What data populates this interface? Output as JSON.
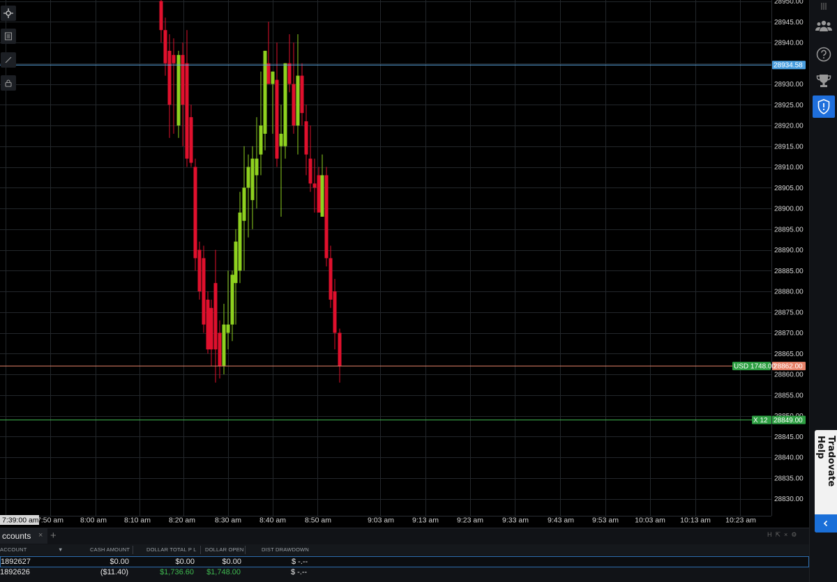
{
  "chart": {
    "price_labels": [
      "28950.00",
      "28945.00",
      "28940.00",
      "28930.00",
      "28925.00",
      "28920.00",
      "28915.00",
      "28910.00",
      "28905.00",
      "28900.00",
      "28895.00",
      "28890.00",
      "28885.00",
      "28880.00",
      "28875.00",
      "28870.00",
      "28865.00",
      "28860.00",
      "28855.00",
      "28850.00",
      "28845.00",
      "28840.00",
      "28835.00",
      "28830.00"
    ],
    "time_labels": [
      "7:50 am",
      "8:00 am",
      "8:10 am",
      "8:20 am",
      "8:30 am",
      "8:40 am",
      "8:50 am",
      "9:03 am",
      "9:13 am",
      "9:23 am",
      "9:33 am",
      "9:43 am",
      "9:53 am",
      "10:03 am",
      "10:13 am",
      "10:23 am"
    ],
    "crosshair_time": "7:39:00 am",
    "blue_line": {
      "price": "28934.58",
      "color": "#5aa9e6"
    },
    "orange_line": {
      "price": "28862.00",
      "pl_label": "USD 1748.00",
      "color": "#e8836a",
      "pl_color": "#2ea043"
    },
    "green_line": {
      "price": "28849.00",
      "qty_label": "X  12",
      "color": "#3fb950"
    },
    "colors": {
      "up": "#8ed11f",
      "down": "#e0102d",
      "grid": "#23272b",
      "axis_text": "#d8d8d8"
    }
  },
  "left_toolbar": {
    "tools": [
      {
        "name": "crosshair-icon"
      },
      {
        "name": "notes-icon"
      },
      {
        "name": "draw-line-icon"
      },
      {
        "name": "lock-icon"
      }
    ]
  },
  "right_sidebar": {
    "icons": [
      "menu-icon",
      "community-icon",
      "help-circle-icon",
      "trophy-icon",
      "shield-icon"
    ],
    "help_tab_label": "Tradovate Help"
  },
  "accounts": {
    "tab_label": "ccounts",
    "tab_close": "×",
    "tab_add": "+",
    "panel_controls": [
      "H",
      "⇱",
      "×",
      "⚙"
    ],
    "columns": [
      "ACCOUNT",
      "CASH AMOUNT",
      "DOLLAR TOTAL P L",
      "DOLLAR OPEN",
      "DIST DRAWDOWN"
    ],
    "sort_arrow": "▼",
    "rows": [
      {
        "account": "1892627",
        "cash": "$0.00",
        "total_pl": "$0.00",
        "open": "$0.00",
        "drawdown": "$ -.--"
      },
      {
        "account": "1892626",
        "cash": "($11.40)",
        "total_pl": "$1,736.60",
        "open": "$1,748.00",
        "drawdown": "$ -.--"
      }
    ]
  }
}
